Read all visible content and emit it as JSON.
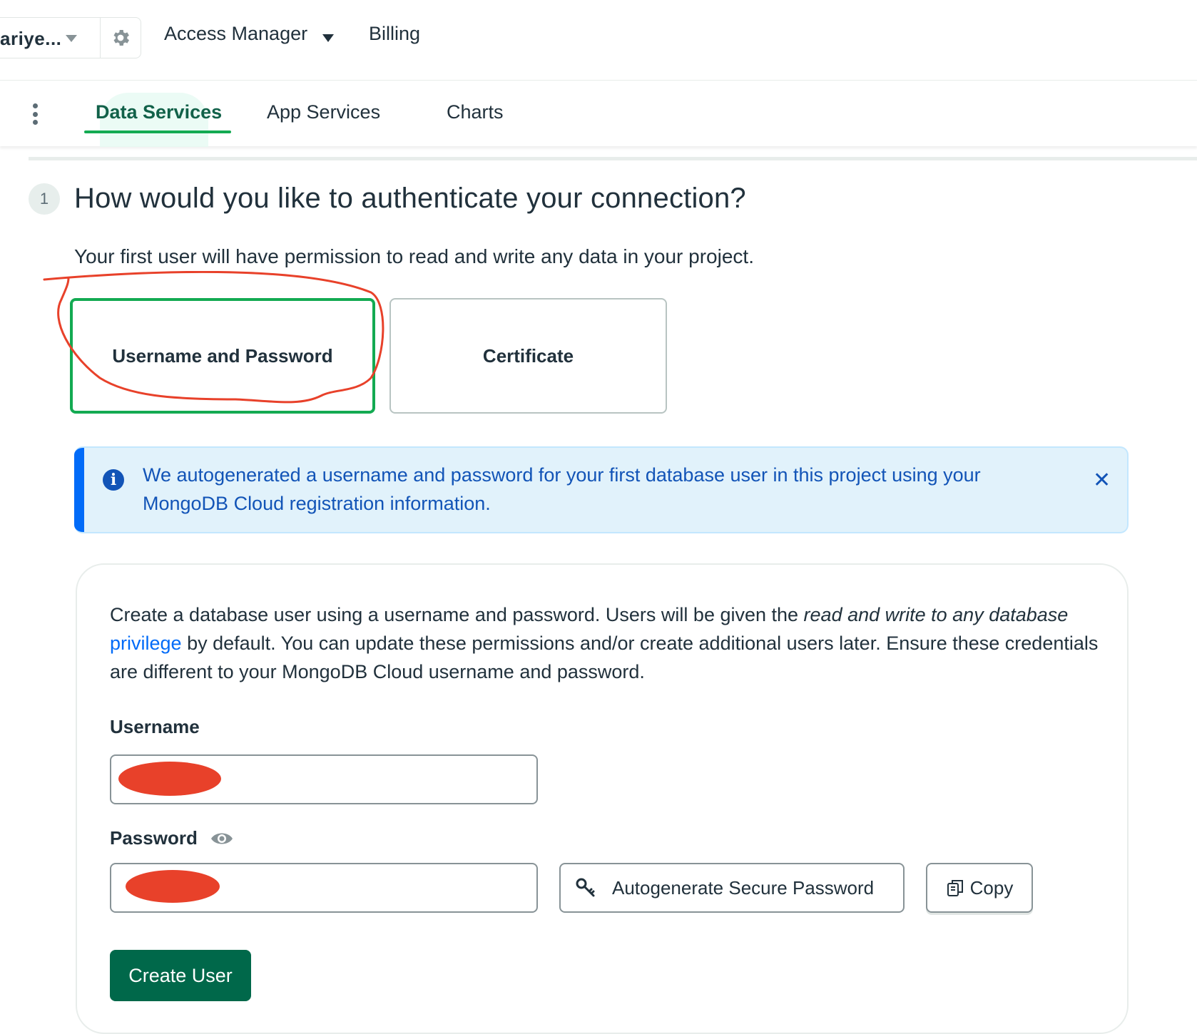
{
  "topbar": {
    "org_name": "ariye...",
    "nav": {
      "access_manager": "Access Manager",
      "billing": "Billing"
    }
  },
  "tabs": [
    {
      "label": "Data Services",
      "active": true
    },
    {
      "label": "App Services",
      "active": false
    },
    {
      "label": "Charts",
      "active": false
    }
  ],
  "step": {
    "number": "1",
    "title": "How would you like to authenticate your connection?",
    "subtitle": "Your first user will have permission to read and write any data in your project."
  },
  "auth_options": [
    {
      "label": "Username and Password",
      "selected": true
    },
    {
      "label": "Certificate",
      "selected": false
    }
  ],
  "banner": {
    "text": "We autogenerated a username and password for your first database user in this project using your MongoDB Cloud registration information.",
    "close_icon": "close-icon"
  },
  "form": {
    "description_part1": "Create a database user using a username and password. Users will be given the ",
    "description_italic": "read and write to any database",
    "description_link": "privilege",
    "description_part2": " by default. You can update these permissions and/or create additional users later. Ensure these credentials are different to your MongoDB Cloud username and password.",
    "username_label": "Username",
    "username_value": "",
    "password_label": "Password",
    "password_value": "",
    "autogen_button": "Autogenerate Secure Password",
    "copy_button": "Copy",
    "create_button": "Create User"
  },
  "colors": {
    "brand_green": "#00684a",
    "selected_border": "#13aa52",
    "info_blue": "#1254b7",
    "annotation_red": "#e8412a"
  }
}
